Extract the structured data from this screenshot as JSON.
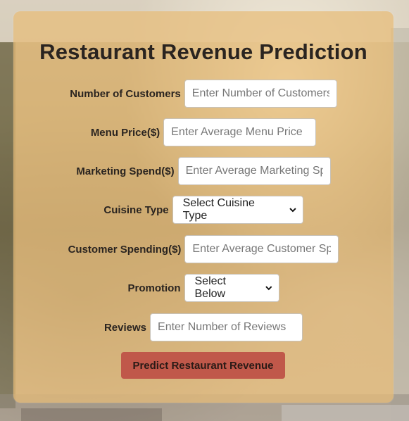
{
  "form": {
    "title": "Restaurant Revenue Prediction",
    "fields": {
      "customers": {
        "label": "Number of Customers",
        "placeholder": "Enter Number of Customers"
      },
      "menu_price": {
        "label": "Menu Price($)",
        "placeholder": "Enter Average Menu Price"
      },
      "marketing": {
        "label": "Marketing Spend($)",
        "placeholder": "Enter Average Marketing Spend"
      },
      "cuisine": {
        "label": "Cuisine Type",
        "selected": "Select Cuisine Type"
      },
      "customer_spending": {
        "label": "Customer Spending($)",
        "placeholder": "Enter Average Customer Spending"
      },
      "promotion": {
        "label": "Promotion",
        "selected": "Select Below"
      },
      "reviews": {
        "label": "Reviews",
        "placeholder": "Enter Number of Reviews"
      }
    },
    "submit_label": "Predict Restaurant Revenue"
  },
  "colors": {
    "panel": "#e8bc78",
    "button": "#c0584a",
    "text": "#2a2420"
  }
}
